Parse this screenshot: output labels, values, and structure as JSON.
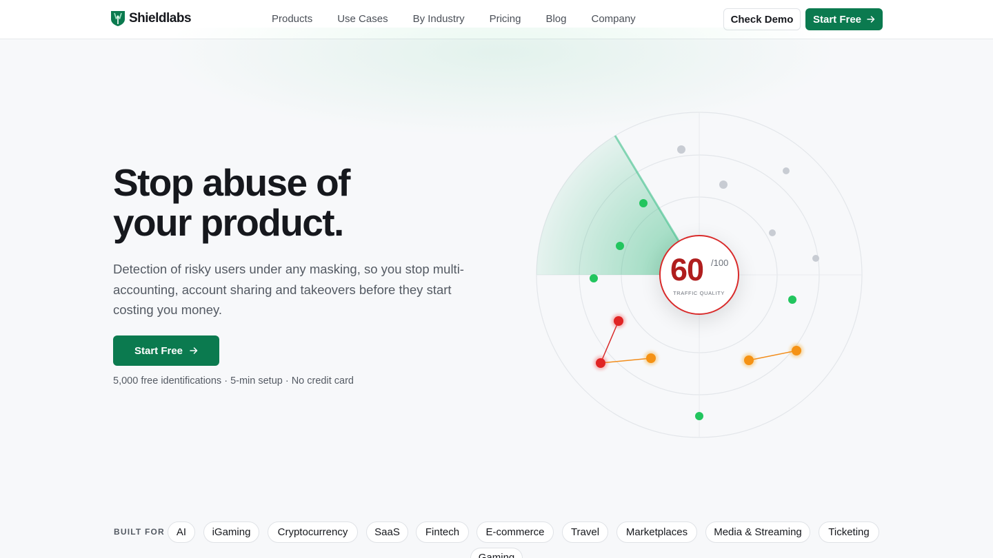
{
  "brand": {
    "name": "Shieldlabs",
    "accent": "#0b7a4f"
  },
  "nav": {
    "items": [
      "Products",
      "Use Cases",
      "By Industry",
      "Pricing",
      "Blog",
      "Company"
    ]
  },
  "header": {
    "demo_label": "Check Demo",
    "start_label": "Start Free"
  },
  "hero": {
    "title_line1": "Stop abuse of",
    "title_line2": "your product.",
    "subtitle": "Detection of risky users under any masking, so you stop multi-accounting, account sharing and takeovers before they start costing you money.",
    "cta_label": "Start Free",
    "note": "5,000 free identifications · 5-min setup · No credit card"
  },
  "score": {
    "value": "60",
    "max": "/100",
    "label": "TRAFFIC QUALITY",
    "status_color": "#d92a2a"
  },
  "built_for": {
    "label": "BUILT FOR",
    "industries": [
      "AI",
      "iGaming",
      "Cryptocurrency",
      "SaaS",
      "Fintech",
      "E-commerce",
      "Travel",
      "Marketplaces",
      "Media & Streaming",
      "Ticketing",
      "Gaming"
    ]
  }
}
